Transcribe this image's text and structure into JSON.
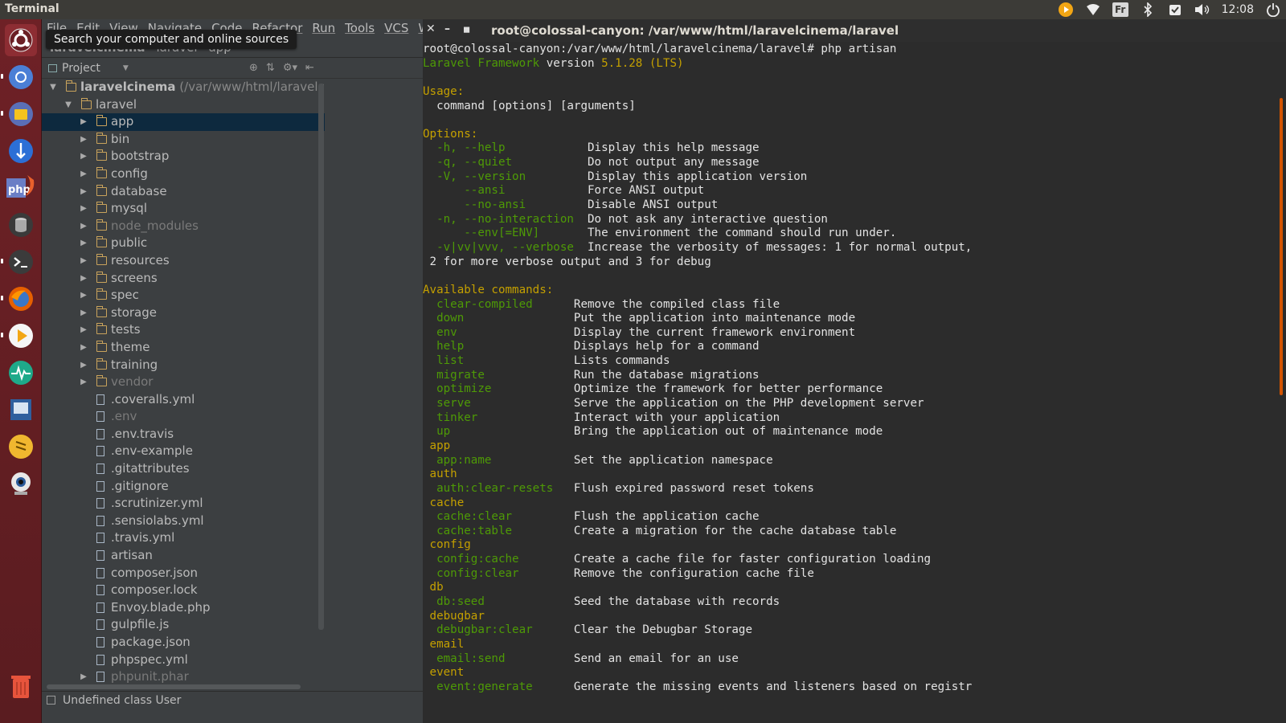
{
  "topbar": {
    "app_title": "Terminal",
    "keyboard": "Fr",
    "clock": "12:08"
  },
  "launcher": {
    "tooltip": "Search your computer and online sources",
    "items": [
      "dash",
      "chromium",
      "files",
      "filezilla",
      "phpstorm",
      "database",
      "terminal",
      "firefox",
      "media-player",
      "system-monitor",
      "presentation",
      "sublime",
      "webcam",
      "trash"
    ],
    "php_label": "php"
  },
  "ide": {
    "menu": [
      "File",
      "Edit",
      "View",
      "Navigate",
      "Code",
      "Refactor",
      "Run",
      "Tools",
      "VCS",
      "Wi"
    ],
    "breadcrumbs": [
      "laravelcinema",
      "laravel",
      "app"
    ],
    "project_label": "Project",
    "tree": [
      {
        "label": "laravelcinema",
        "suffix": " (/var/www/html/laravelcinem",
        "type": "folder",
        "depth": 0,
        "expanded": true
      },
      {
        "label": "laravel",
        "type": "folder",
        "depth": 1,
        "expanded": true
      },
      {
        "label": "app",
        "type": "folder",
        "depth": 2,
        "selected": true
      },
      {
        "label": "bin",
        "type": "folder",
        "depth": 2
      },
      {
        "label": "bootstrap",
        "type": "folder",
        "depth": 2
      },
      {
        "label": "config",
        "type": "folder",
        "depth": 2
      },
      {
        "label": "database",
        "type": "folder",
        "depth": 2
      },
      {
        "label": "mysql",
        "type": "folder",
        "depth": 2
      },
      {
        "label": "node_modules",
        "type": "folder",
        "depth": 2,
        "muted": true
      },
      {
        "label": "public",
        "type": "folder",
        "depth": 2
      },
      {
        "label": "resources",
        "type": "folder",
        "depth": 2
      },
      {
        "label": "screens",
        "type": "folder",
        "depth": 2
      },
      {
        "label": "spec",
        "type": "folder",
        "depth": 2
      },
      {
        "label": "storage",
        "type": "folder",
        "depth": 2
      },
      {
        "label": "tests",
        "type": "folder",
        "depth": 2
      },
      {
        "label": "theme",
        "type": "folder",
        "depth": 2
      },
      {
        "label": "training",
        "type": "folder",
        "depth": 2
      },
      {
        "label": "vendor",
        "type": "folder",
        "depth": 2,
        "muted": true
      },
      {
        "label": ".coveralls.yml",
        "type": "file",
        "depth": 2
      },
      {
        "label": ".env",
        "type": "file",
        "depth": 2,
        "muted": true
      },
      {
        "label": ".env.travis",
        "type": "file",
        "depth": 2
      },
      {
        "label": ".env-example",
        "type": "file",
        "depth": 2
      },
      {
        "label": ".gitattributes",
        "type": "file",
        "depth": 2
      },
      {
        "label": ".gitignore",
        "type": "file",
        "depth": 2
      },
      {
        "label": ".scrutinizer.yml",
        "type": "file",
        "depth": 2
      },
      {
        "label": ".sensiolabs.yml",
        "type": "file",
        "depth": 2
      },
      {
        "label": ".travis.yml",
        "type": "file",
        "depth": 2
      },
      {
        "label": "artisan",
        "type": "file",
        "depth": 2
      },
      {
        "label": "composer.json",
        "type": "file",
        "depth": 2
      },
      {
        "label": "composer.lock",
        "type": "file",
        "depth": 2
      },
      {
        "label": "Envoy.blade.php",
        "type": "file",
        "depth": 2
      },
      {
        "label": "gulpfile.js",
        "type": "file",
        "depth": 2
      },
      {
        "label": "package.json",
        "type": "file",
        "depth": 2
      },
      {
        "label": "phpspec.yml",
        "type": "file",
        "depth": 2
      },
      {
        "label": "phpunit.phar",
        "type": "file",
        "depth": 2,
        "collapsed_arrow": true,
        "muted": true
      }
    ],
    "status": "Undefined class User"
  },
  "terminal": {
    "title": "root@colossal-canyon: /var/www/html/laravelcinema/laravel",
    "lines": [
      {
        "segs": [
          {
            "t": "root@colossal-canyon:/var/www/html/laravelcinema/laravel# php artisan",
            "c": ""
          }
        ]
      },
      {
        "segs": [
          {
            "t": "Laravel Framework",
            "c": "g"
          },
          {
            "t": " version ",
            "c": ""
          },
          {
            "t": "5.1.28 (LTS)",
            "c": "y"
          }
        ]
      },
      {
        "segs": []
      },
      {
        "segs": [
          {
            "t": "Usage:",
            "c": "y"
          }
        ]
      },
      {
        "segs": [
          {
            "t": "  command [options] [arguments]",
            "c": ""
          }
        ]
      },
      {
        "segs": []
      },
      {
        "segs": [
          {
            "t": "Options:",
            "c": "y"
          }
        ]
      },
      {
        "segs": [
          {
            "t": "  -h, --help            ",
            "c": "g"
          },
          {
            "t": "Display this help message",
            "c": ""
          }
        ]
      },
      {
        "segs": [
          {
            "t": "  -q, --quiet           ",
            "c": "g"
          },
          {
            "t": "Do not output any message",
            "c": ""
          }
        ]
      },
      {
        "segs": [
          {
            "t": "  -V, --version         ",
            "c": "g"
          },
          {
            "t": "Display this application version",
            "c": ""
          }
        ]
      },
      {
        "segs": [
          {
            "t": "      --ansi            ",
            "c": "g"
          },
          {
            "t": "Force ANSI output",
            "c": ""
          }
        ]
      },
      {
        "segs": [
          {
            "t": "      --no-ansi         ",
            "c": "g"
          },
          {
            "t": "Disable ANSI output",
            "c": ""
          }
        ]
      },
      {
        "segs": [
          {
            "t": "  -n, --no-interaction  ",
            "c": "g"
          },
          {
            "t": "Do not ask any interactive question",
            "c": ""
          }
        ]
      },
      {
        "segs": [
          {
            "t": "      --env[=ENV]       ",
            "c": "g"
          },
          {
            "t": "The environment the command should run under.",
            "c": ""
          }
        ]
      },
      {
        "segs": [
          {
            "t": "  -v|vv|vvv, --verbose  ",
            "c": "g"
          },
          {
            "t": "Increase the verbosity of messages: 1 for normal output,",
            "c": ""
          }
        ]
      },
      {
        "segs": [
          {
            "t": " 2 for more verbose output and 3 for debug",
            "c": ""
          }
        ]
      },
      {
        "segs": []
      },
      {
        "segs": [
          {
            "t": "Available commands:",
            "c": "y"
          }
        ]
      },
      {
        "segs": [
          {
            "t": "  clear-compiled      ",
            "c": "g"
          },
          {
            "t": "Remove the compiled class file",
            "c": ""
          }
        ]
      },
      {
        "segs": [
          {
            "t": "  down                ",
            "c": "g"
          },
          {
            "t": "Put the application into maintenance mode",
            "c": ""
          }
        ]
      },
      {
        "segs": [
          {
            "t": "  env                 ",
            "c": "g"
          },
          {
            "t": "Display the current framework environment",
            "c": ""
          }
        ]
      },
      {
        "segs": [
          {
            "t": "  help                ",
            "c": "g"
          },
          {
            "t": "Displays help for a command",
            "c": ""
          }
        ]
      },
      {
        "segs": [
          {
            "t": "  list                ",
            "c": "g"
          },
          {
            "t": "Lists commands",
            "c": ""
          }
        ]
      },
      {
        "segs": [
          {
            "t": "  migrate             ",
            "c": "g"
          },
          {
            "t": "Run the database migrations",
            "c": ""
          }
        ]
      },
      {
        "segs": [
          {
            "t": "  optimize            ",
            "c": "g"
          },
          {
            "t": "Optimize the framework for better performance",
            "c": ""
          }
        ]
      },
      {
        "segs": [
          {
            "t": "  serve               ",
            "c": "g"
          },
          {
            "t": "Serve the application on the PHP development server",
            "c": ""
          }
        ]
      },
      {
        "segs": [
          {
            "t": "  tinker              ",
            "c": "g"
          },
          {
            "t": "Interact with your application",
            "c": ""
          }
        ]
      },
      {
        "segs": [
          {
            "t": "  up                  ",
            "c": "g"
          },
          {
            "t": "Bring the application out of maintenance mode",
            "c": ""
          }
        ]
      },
      {
        "segs": [
          {
            "t": " app",
            "c": "y"
          }
        ]
      },
      {
        "segs": [
          {
            "t": "  app:name            ",
            "c": "g"
          },
          {
            "t": "Set the application namespace",
            "c": ""
          }
        ]
      },
      {
        "segs": [
          {
            "t": " auth",
            "c": "y"
          }
        ]
      },
      {
        "segs": [
          {
            "t": "  auth:clear-resets   ",
            "c": "g"
          },
          {
            "t": "Flush expired password reset tokens",
            "c": ""
          }
        ]
      },
      {
        "segs": [
          {
            "t": " cache",
            "c": "y"
          }
        ]
      },
      {
        "segs": [
          {
            "t": "  cache:clear         ",
            "c": "g"
          },
          {
            "t": "Flush the application cache",
            "c": ""
          }
        ]
      },
      {
        "segs": [
          {
            "t": "  cache:table         ",
            "c": "g"
          },
          {
            "t": "Create a migration for the cache database table",
            "c": ""
          }
        ]
      },
      {
        "segs": [
          {
            "t": " config",
            "c": "y"
          }
        ]
      },
      {
        "segs": [
          {
            "t": "  config:cache        ",
            "c": "g"
          },
          {
            "t": "Create a cache file for faster configuration loading",
            "c": ""
          }
        ]
      },
      {
        "segs": [
          {
            "t": "  config:clear        ",
            "c": "g"
          },
          {
            "t": "Remove the configuration cache file",
            "c": ""
          }
        ]
      },
      {
        "segs": [
          {
            "t": " db",
            "c": "y"
          }
        ]
      },
      {
        "segs": [
          {
            "t": "  db:seed             ",
            "c": "g"
          },
          {
            "t": "Seed the database with records",
            "c": ""
          }
        ]
      },
      {
        "segs": [
          {
            "t": " debugbar",
            "c": "y"
          }
        ]
      },
      {
        "segs": [
          {
            "t": "  debugbar:clear      ",
            "c": "g"
          },
          {
            "t": "Clear the Debugbar Storage",
            "c": ""
          }
        ]
      },
      {
        "segs": [
          {
            "t": " email",
            "c": "y"
          }
        ]
      },
      {
        "segs": [
          {
            "t": "  email:send          ",
            "c": "g"
          },
          {
            "t": "Send an email for an use",
            "c": ""
          }
        ]
      },
      {
        "segs": [
          {
            "t": " event",
            "c": "y"
          }
        ]
      },
      {
        "segs": [
          {
            "t": "  event:generate      ",
            "c": "g"
          },
          {
            "t": "Generate the missing events and listeners based on registr",
            "c": ""
          }
        ]
      }
    ]
  }
}
